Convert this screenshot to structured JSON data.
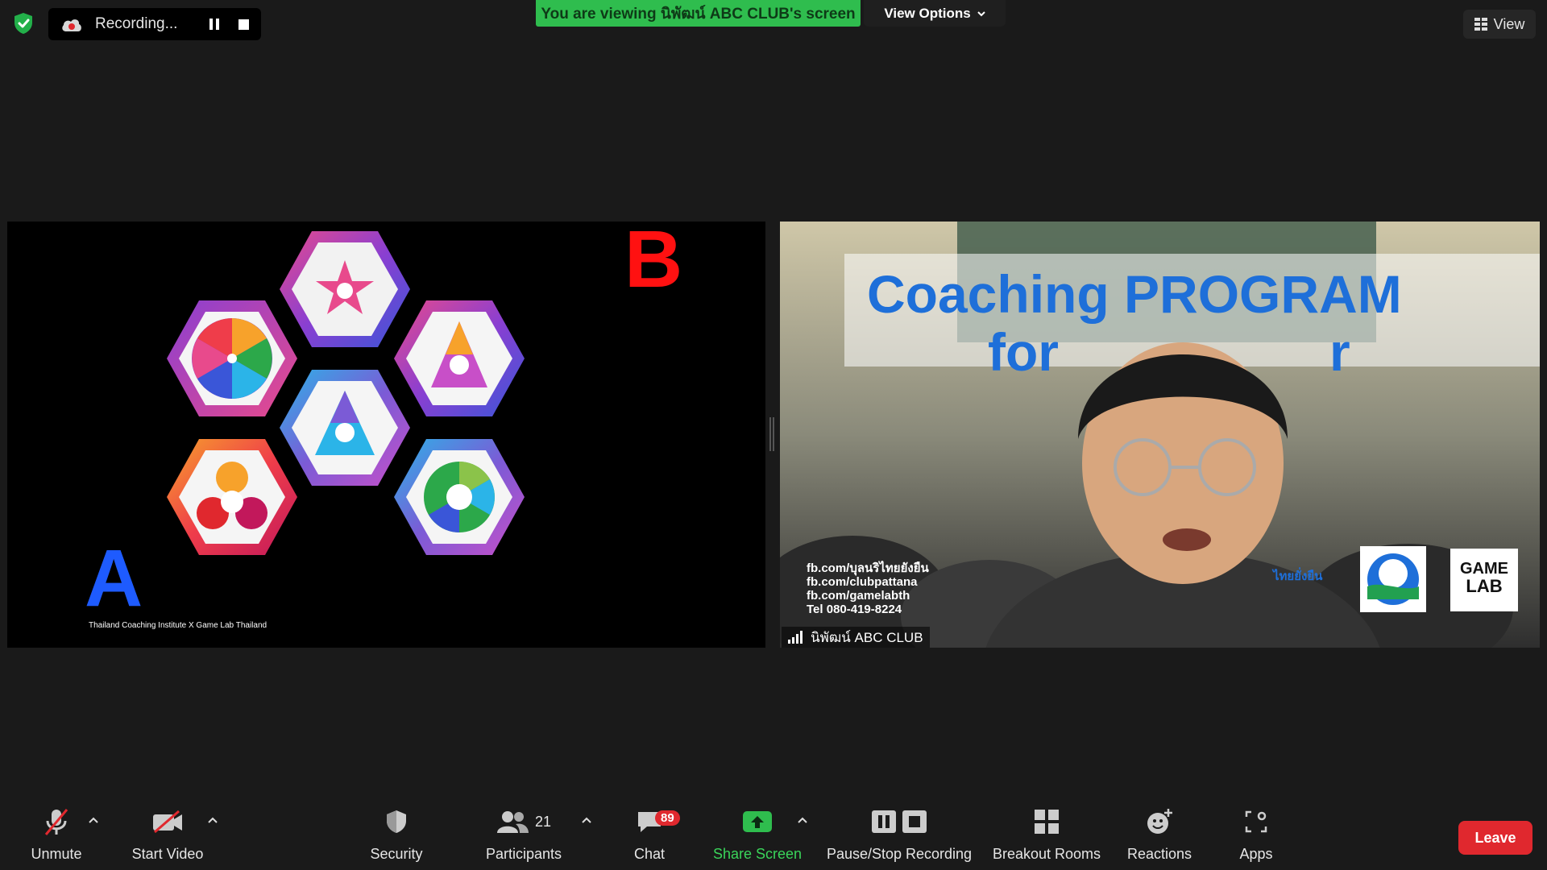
{
  "recording": {
    "label": "Recording..."
  },
  "banner": {
    "text": "You are viewing นิพัฒน์ ABC CLUB's screen",
    "view_options": "View Options"
  },
  "view_button": {
    "label": "View"
  },
  "shared_screen": {
    "letter_a": "A",
    "letter_b": "B",
    "credit": "Thailand Coaching Institute X Game Lab Thailand"
  },
  "video": {
    "participant_name": "นิพัฒน์ ABC CLUB",
    "slide_title_1": "Coaching PROGRAM",
    "slide_title_2": "for",
    "slide_title_2b": "r",
    "links": [
      "fb.com/บุลนริไทยยังยืน",
      "fb.com/clubpattana",
      "fb.com/gamelabth",
      "Tel 080-419-8224"
    ],
    "logo_text": "ไทยยั่งยืน",
    "gamelab_text_1": "GAME",
    "gamelab_text_2": "LAB"
  },
  "toolbar": {
    "unmute": "Unmute",
    "start_video": "Start Video",
    "security": "Security",
    "participants": "Participants",
    "participants_count": "21",
    "chat": "Chat",
    "chat_badge": "89",
    "share_screen": "Share Screen",
    "pause_stop": "Pause/Stop Recording",
    "breakout": "Breakout Rooms",
    "reactions": "Reactions",
    "apps": "Apps",
    "leave": "Leave"
  },
  "colors": {
    "green": "#2fbd4e",
    "leave_red": "#e0282e",
    "letter_b": "#ff1111",
    "letter_a": "#1e5bff"
  }
}
